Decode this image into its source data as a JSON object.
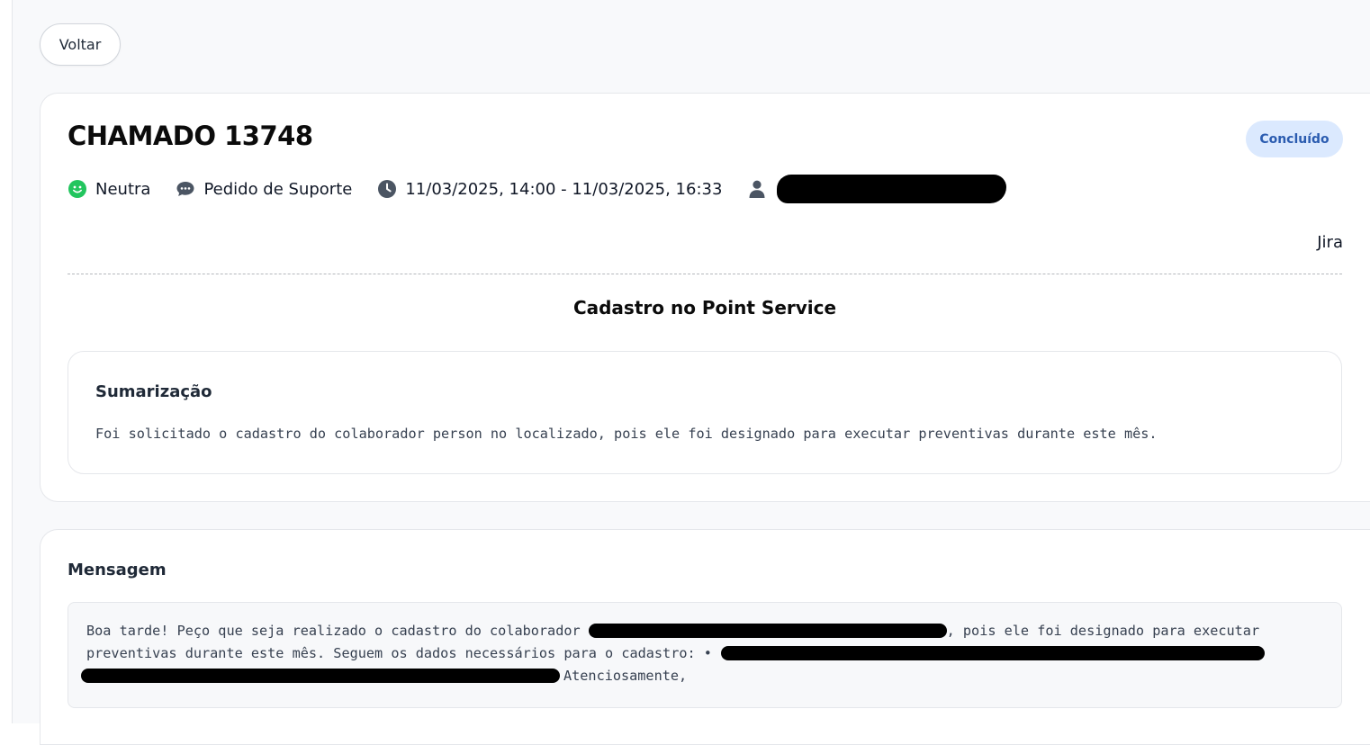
{
  "back_button": {
    "label": "Voltar"
  },
  "ticket": {
    "title": "CHAMADO 13748",
    "status": "Concluído",
    "sentiment": "Neutra",
    "type": "Pedido de Suporte",
    "period": "11/03/2025, 14:00 - 11/03/2025, 16:33",
    "source": "Jira",
    "subject": "Cadastro no Point Service"
  },
  "summary": {
    "heading": "Sumarização",
    "text": "Foi solicitado o cadastro do colaborador person no localizado, pois ele foi designado para executar preventivas durante este mês."
  },
  "message": {
    "heading": "Mensagem",
    "line1_start": "Boa tarde! Peço que seja realizado o cadastro do colaborador",
    "line1_end": ", pois ele foi designado para executar",
    "line2_start": "preventivas durante este mês. Seguem os dados necessários para o cadastro: •",
    "line3_end": "Atenciosamente,"
  },
  "colors": {
    "status_bg": "#dbe9fe",
    "status_text": "#2b5cb0",
    "sentiment_icon": "#22c55e",
    "icon_gray": "#4b5563"
  },
  "icons": {
    "sentiment": "smile-icon",
    "type": "chat-bubble-icon",
    "period": "clock-icon",
    "user": "user-icon"
  }
}
